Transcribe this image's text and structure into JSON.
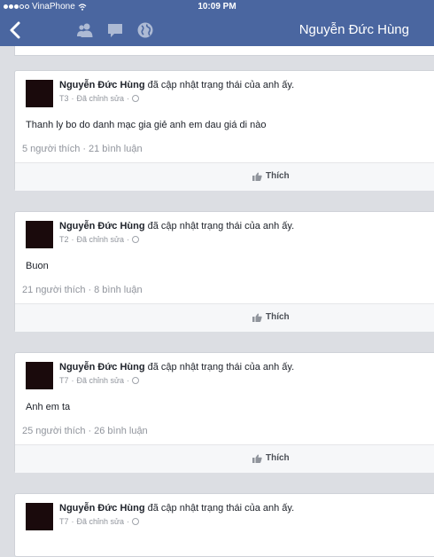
{
  "status_bar": {
    "carrier": "VinaPhone",
    "time": "10:09 PM"
  },
  "nav": {
    "title": "Nguyễn Đức Hùng",
    "icons": [
      "back-chevron-icon",
      "friends-icon",
      "messages-icon",
      "globe-notifications-icon"
    ]
  },
  "posts": [
    {
      "author": "Nguyễn Đức Hùng",
      "action": "đã cập nhật trạng thái của anh ấy.",
      "date": "T3",
      "edited": "Đã chỉnh sửa",
      "text": "Thanh ly bo do danh mạc gia giẻ anh em dau giá di nào",
      "likes": "5 người thích",
      "comments": "21 bình luận",
      "like_label": "Thích"
    },
    {
      "author": "Nguyễn Đức Hùng",
      "action": "đã cập nhật trạng thái của anh ấy.",
      "date": "T2",
      "edited": "Đã chỉnh sửa",
      "text": "Buon",
      "likes": "21 người thích",
      "comments": "8 bình luận",
      "like_label": "Thích"
    },
    {
      "author": "Nguyễn Đức Hùng",
      "action": "đã cập nhật trạng thái của anh ấy.",
      "date": "T7",
      "edited": "Đã chỉnh sửa",
      "text": "Anh em ta",
      "likes": "25 người thích",
      "comments": "26 bình luận",
      "like_label": "Thích"
    },
    {
      "author": "Nguyễn Đức Hùng",
      "action": "đã cập nhật trạng thái của anh ấy.",
      "date": "T7",
      "edited": "Đã chỉnh sửa"
    }
  ],
  "separator": "·",
  "colors": {
    "brand": "#4a66a0",
    "background": "#dcdee3",
    "muted_text": "#90949c"
  }
}
